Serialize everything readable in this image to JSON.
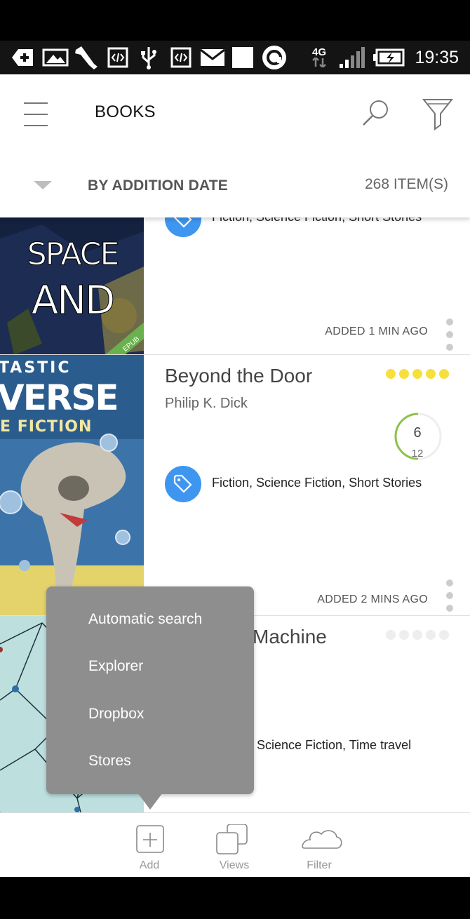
{
  "status_bar": {
    "time": "19:35",
    "network": "4G",
    "icons": [
      "add-icon",
      "gallery-icon",
      "wrench-icon",
      "code-icon",
      "usb-icon",
      "code-icon",
      "mail-icon",
      "square-icon",
      "circle-app-icon",
      "signal-icon",
      "battery-icon"
    ]
  },
  "app_bar": {
    "title": "BOOKS",
    "sort_label": "BY ADDITION DATE",
    "item_count": "268 ITEM(S)"
  },
  "books": [
    {
      "title": "",
      "author": "",
      "tags": "Fiction, Science Fiction, Short Stories",
      "added": "ADDED 1 MIN AGO",
      "format_badge": "EPUB",
      "cover_text": [
        "SPACE",
        "AND"
      ]
    },
    {
      "title": "Beyond the Door",
      "author": "Philip K. Dick",
      "tags": "Fiction, Science Fiction, Short Stories",
      "added": "ADDED 2 MINS AGO",
      "rating": 5,
      "progress_current": "6",
      "progress_total": "12",
      "progress_fraction": 0.5,
      "cover_text": [
        "TASTIC",
        "VERSE",
        "E FICTION"
      ]
    },
    {
      "title": "Machine",
      "tags": "Science Fiction, Time travel",
      "rating": 0
    }
  ],
  "popup_menu": {
    "items": [
      "Automatic search",
      "Explorer",
      "Dropbox",
      "Stores"
    ]
  },
  "bottom_tabs": [
    {
      "label": "Add",
      "icon": "add-box-icon"
    },
    {
      "label": "Views",
      "icon": "views-icon"
    },
    {
      "label": "Filter",
      "icon": "cloud-icon"
    }
  ],
  "colors": {
    "tag_blue": "#3f96f0",
    "star_yellow": "#f7e03c",
    "star_empty": "#eeeeee",
    "progress_green": "#8bc34a",
    "popup_gray": "#8e8e8e",
    "epub_green": "#6ab04c"
  }
}
